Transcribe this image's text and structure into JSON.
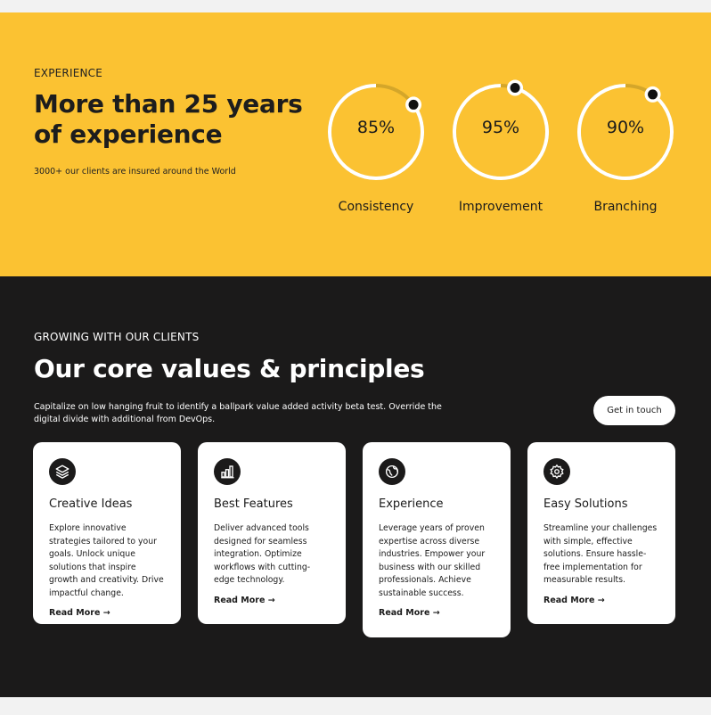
{
  "experience": {
    "eyebrow": "EXPERIENCE",
    "headline": "More than 25 years of experience",
    "subtext": "3000+ our clients are insured around the World",
    "stats": [
      {
        "value": "85%",
        "label": "Consistency",
        "percent": 0.85
      },
      {
        "value": "95%",
        "label": "Improvement",
        "percent": 0.95
      },
      {
        "value": "90%",
        "label": "Branching",
        "percent": 0.9
      }
    ]
  },
  "values": {
    "eyebrow": "GROWING WITH OUR CLIENTS",
    "headline": "Our core values & principles",
    "description": "Capitalize on low hanging fruit to identify a ballpark value added activity beta test. Override the digital divide with additional from DevOps.",
    "cta_label": "Get in touch",
    "cards": [
      {
        "icon": "layers-icon",
        "title": "Creative Ideas",
        "body": "Explore innovative strategies tailored to your goals. Unlock unique solutions that inspire growth and creativity. Drive impactful change.",
        "link": "Read More →"
      },
      {
        "icon": "bar-chart-icon",
        "title": "Best Features",
        "body": "Deliver advanced tools designed for seamless integration. Optimize workflows with cutting-edge technology.",
        "link": "Read More →"
      },
      {
        "icon": "globe-icon",
        "title": "Experience",
        "body": "Leverage years of proven expertise across diverse industries. Empower your business with our skilled professionals. Achieve sustainable success.",
        "link": "Read More →"
      },
      {
        "icon": "gear-icon",
        "title": "Easy Solutions",
        "body": "Streamline your challenges with simple, effective solutions. Ensure hassle-free implementation for measurable results.",
        "link": "Read More →"
      }
    ]
  },
  "colors": {
    "accent_yellow": "#fbc232",
    "dark_bg": "#1b1a1a",
    "ring_track": "#d4a62a",
    "ring_fill": "#ffffff"
  }
}
